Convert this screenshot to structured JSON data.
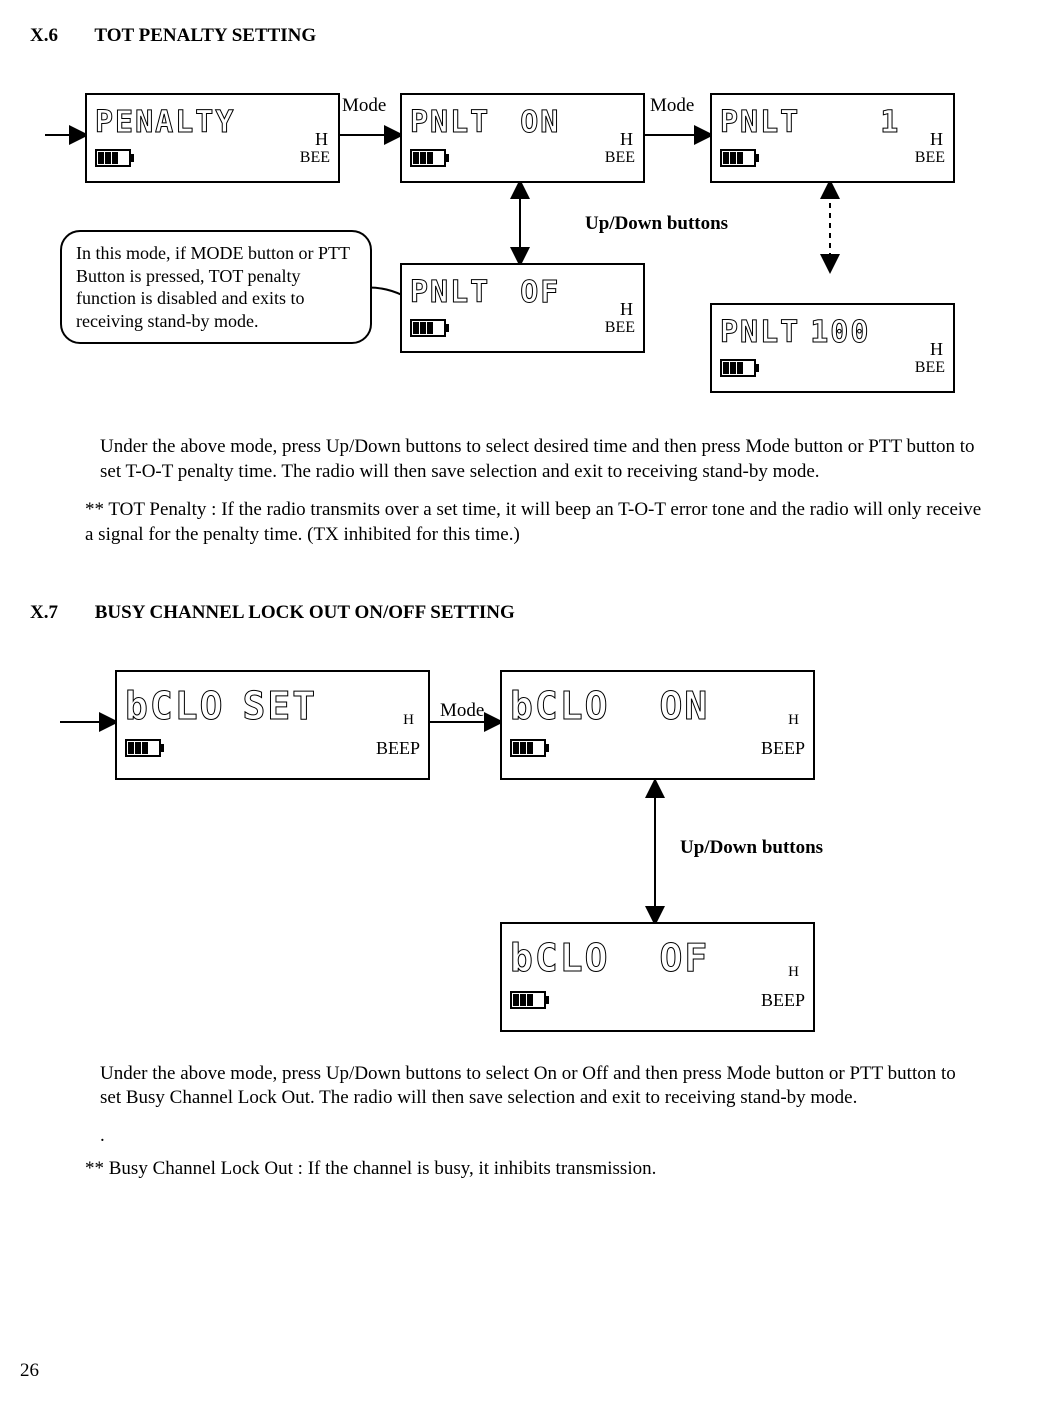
{
  "page_number": "26",
  "sections": {
    "x6": {
      "num": "X.6",
      "title": "TOT PENALTY SETTING",
      "callout": "In this mode, if MODE button or  PTT Button is pressed, TOT penalty function is disabled and exits to receiving stand-by mode.",
      "mode_label_1": "Mode",
      "mode_label_2": "Mode",
      "updown_label": "Up/Down buttons",
      "lcd": {
        "penalty": {
          "main": "PENALTY",
          "h": "H",
          "beep": "BEE"
        },
        "pnlt_on": {
          "main": "PNLT",
          "right": "ON",
          "h": "H",
          "beep": "BEE"
        },
        "pnlt_1": {
          "main": "PNLT",
          "right": "1",
          "h": "H",
          "beep": "BEE"
        },
        "pnlt_of": {
          "main": "PNLT",
          "right": "OF",
          "h": "H",
          "beep": "BEE"
        },
        "pnlt_100": {
          "main": "PNLT",
          "right": "100",
          "h": "H",
          "beep": "BEE"
        }
      },
      "para1": "Under the above mode, press Up/Down buttons to select desired time and then press Mode button or PTT button to set T-O-T penalty time. The radio will then save selection and exit to receiving stand-by mode.",
      "def_label": "**  TOT Penalty : ",
      "def_text": "If the radio transmits over a set time, it will beep an T-O-T error tone and the radio will only receive a signal for the penalty time. (TX inhibited for this time.)"
    },
    "x7": {
      "num": "X.7",
      "title": "BUSY CHANNEL LOCK OUT ON/OFF SETTING",
      "mode_label": "Mode",
      "updown_label": "Up/Down buttons",
      "lcd": {
        "bclo_set": {
          "main": "bCLO",
          "right": "SET",
          "h": "H",
          "beep": "BEEP"
        },
        "bclo_on": {
          "main": "bCLO",
          "right": "ON",
          "h": "H",
          "beep": "BEEP"
        },
        "bclo_of": {
          "main": "bCLO",
          "right": "OF",
          "h": "H",
          "beep": "BEEP"
        }
      },
      "para1": "Under the above mode, press Up/Down buttons to select On or Off and then press Mode button or PTT button to set Busy Channel Lock Out. The radio will then save selection and exit to receiving stand-by mode.",
      "dot": ".",
      "def": "** Busy Channel Lock Out : If the channel is busy, it inhibits transmission."
    }
  }
}
